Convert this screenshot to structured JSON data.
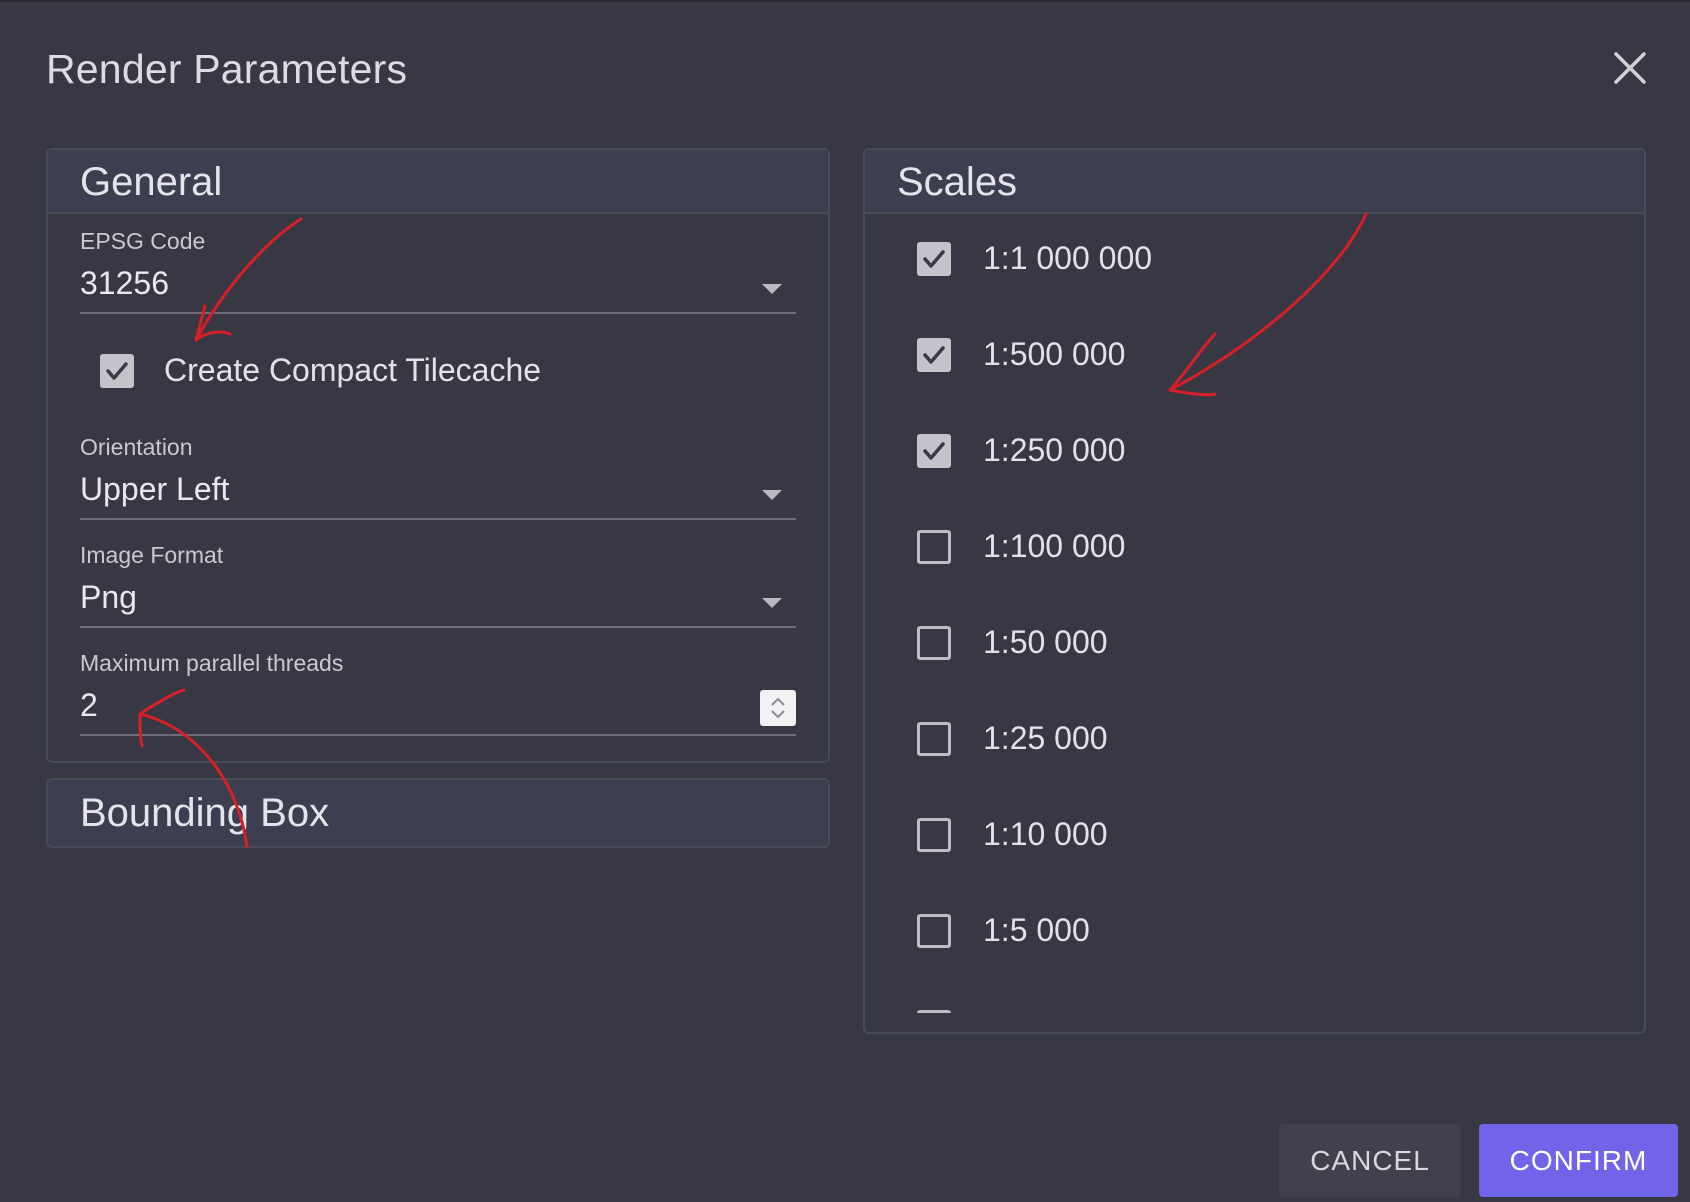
{
  "dialog": {
    "title": "Render Parameters",
    "close_icon": "close-icon"
  },
  "general": {
    "header": "General",
    "epsg": {
      "label": "EPSG Code",
      "value": "31256"
    },
    "compact_tilecache": {
      "label": "Create Compact Tilecache",
      "checked": true
    },
    "orientation": {
      "label": "Orientation",
      "value": "Upper Left"
    },
    "image_format": {
      "label": "Image Format",
      "value": "Png"
    },
    "threads": {
      "label": "Maximum parallel threads",
      "value": "2"
    }
  },
  "bounding_box": {
    "header": "Bounding Box"
  },
  "scales": {
    "header": "Scales",
    "items": [
      {
        "label": "1:1 000 000",
        "checked": true
      },
      {
        "label": "1:500 000",
        "checked": true
      },
      {
        "label": "1:250 000",
        "checked": true
      },
      {
        "label": "1:100 000",
        "checked": false
      },
      {
        "label": "1:50 000",
        "checked": false
      },
      {
        "label": "1:25 000",
        "checked": false
      },
      {
        "label": "1:10 000",
        "checked": false
      },
      {
        "label": "1:5 000",
        "checked": false
      }
    ]
  },
  "actions": {
    "cancel_label": "CANCEL",
    "confirm_label": "CONFIRM"
  },
  "colors": {
    "background": "#373843",
    "panel_header": "#3d3e50",
    "accent": "#7065e8",
    "annotation": "#d61f26"
  }
}
